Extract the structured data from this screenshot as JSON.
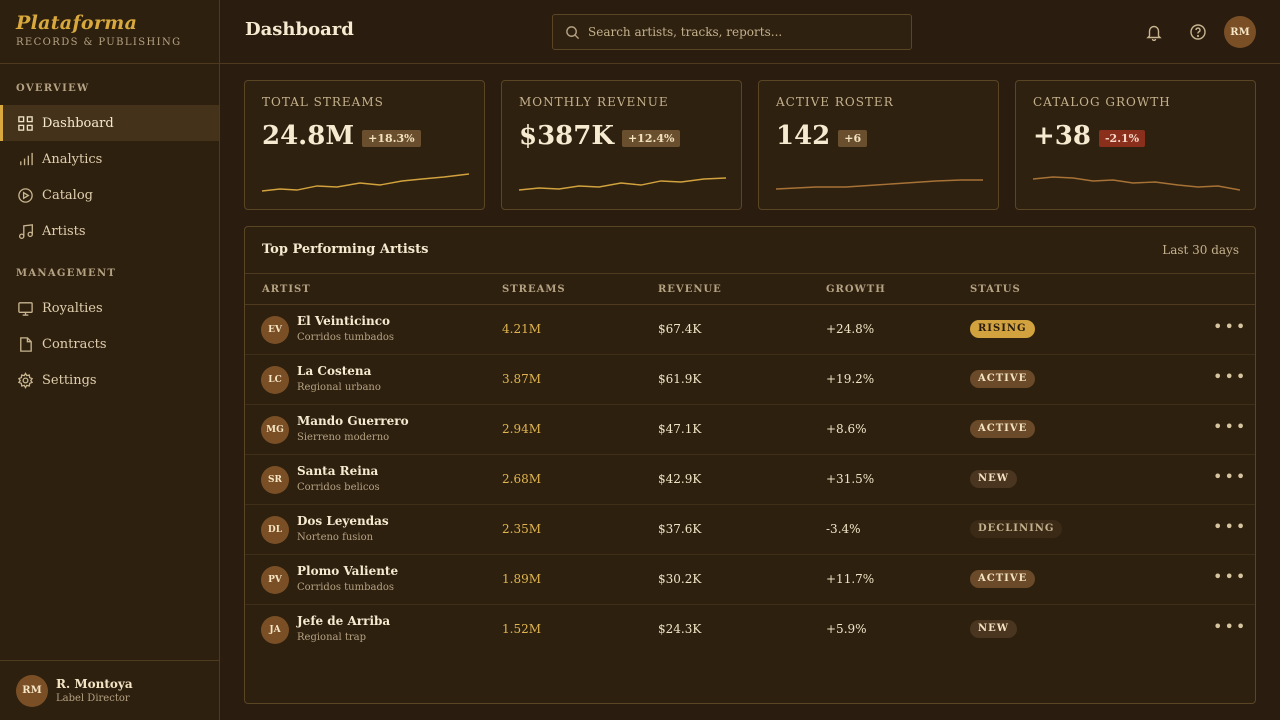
{
  "brand": {
    "name": "Plataforma",
    "subtitle": "RECORDS & PUBLISHING"
  },
  "sidebar": {
    "sections": [
      {
        "title": "OVERVIEW",
        "items": [
          {
            "label": "Dashboard",
            "icon": "grid-icon",
            "active": true
          },
          {
            "label": "Analytics",
            "icon": "bar-chart-icon"
          },
          {
            "label": "Catalog",
            "icon": "play-circle-icon"
          },
          {
            "label": "Artists",
            "icon": "music-note-icon"
          }
        ]
      },
      {
        "title": "MANAGEMENT",
        "items": [
          {
            "label": "Royalties",
            "icon": "monitor-icon"
          },
          {
            "label": "Contracts",
            "icon": "file-icon"
          },
          {
            "label": "Settings",
            "icon": "gear-icon"
          }
        ]
      }
    ]
  },
  "user": {
    "initials": "RM",
    "name": "R. Montoya",
    "role": "Label Director"
  },
  "header": {
    "title": "Dashboard",
    "search_placeholder": "Search artists, tracks, reports...",
    "avatar_initials": "RM"
  },
  "stats": [
    {
      "label": "TOTAL STREAMS",
      "value": "24.8M",
      "delta": "+18.3%",
      "negative": false
    },
    {
      "label": "MONTHLY REVENUE",
      "value": "$387K",
      "delta": "+12.4%",
      "negative": false
    },
    {
      "label": "ACTIVE ROSTER",
      "value": "142",
      "delta": "+6",
      "negative": false
    },
    {
      "label": "CATALOG GROWTH",
      "value": "+38",
      "delta": "-2.1%",
      "negative": true
    }
  ],
  "table": {
    "title": "Top Performing Artists",
    "range": "Last 30 days",
    "columns": [
      "ARTIST",
      "STREAMS",
      "REVENUE",
      "GROWTH",
      "STATUS"
    ],
    "rows": [
      {
        "initials": "EV",
        "name": "El Veinticinco",
        "genre": "Corridos tumbados",
        "streams": "4.21M",
        "revenue": "$67.4K",
        "growth": "+24.8%",
        "status": "RISING",
        "status_kind": "rising"
      },
      {
        "initials": "LC",
        "name": "La Costena",
        "genre": "Regional urbano",
        "streams": "3.87M",
        "revenue": "$61.9K",
        "growth": "+19.2%",
        "status": "ACTIVE",
        "status_kind": "active"
      },
      {
        "initials": "MG",
        "name": "Mando Guerrero",
        "genre": "Sierreno moderno",
        "streams": "2.94M",
        "revenue": "$47.1K",
        "growth": "+8.6%",
        "status": "ACTIVE",
        "status_kind": "active"
      },
      {
        "initials": "SR",
        "name": "Santa Reina",
        "genre": "Corridos belicos",
        "streams": "2.68M",
        "revenue": "$42.9K",
        "growth": "+31.5%",
        "status": "NEW",
        "status_kind": "new"
      },
      {
        "initials": "DL",
        "name": "Dos Leyendas",
        "genre": "Norteno fusion",
        "streams": "2.35M",
        "revenue": "$37.6K",
        "growth": "-3.4%",
        "status": "DECLINING",
        "status_kind": "declining"
      },
      {
        "initials": "PV",
        "name": "Plomo Valiente",
        "genre": "Corridos tumbados",
        "streams": "1.89M",
        "revenue": "$30.2K",
        "growth": "+11.7%",
        "status": "ACTIVE",
        "status_kind": "active"
      },
      {
        "initials": "JA",
        "name": "Jefe de Arriba",
        "genre": "Regional trap",
        "streams": "1.52M",
        "revenue": "$24.3K",
        "growth": "+5.9%",
        "status": "NEW",
        "status_kind": "new"
      }
    ]
  },
  "colors": {
    "accent": "#d9a93e",
    "background": "#2a1d0f",
    "negative": "#8a2f1c"
  }
}
